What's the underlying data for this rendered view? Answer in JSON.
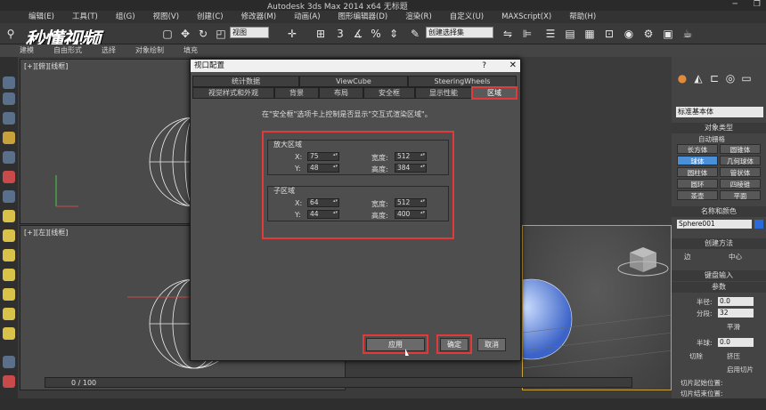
{
  "window": {
    "title": "Autodesk 3ds Max  2014 x64     无标题"
  },
  "menu": [
    "编辑(E)",
    "工具(T)",
    "组(G)",
    "视图(V)",
    "创建(C)",
    "修改器(M)",
    "动画(A)",
    "图形编辑器(D)",
    "渲染(R)",
    "自定义(U)",
    "MAXScript(X)",
    "帮助(H)"
  ],
  "toolbar": {
    "view_select": "视图",
    "selection_set": "创建选择集",
    "logo": "秒懂视频"
  },
  "ribbon": [
    "建模",
    "自由形式",
    "选择",
    "对象绘制",
    "填充"
  ],
  "viewports": {
    "top_left": "[+][俯][线框]",
    "bottom_left": "[+][左][线框]"
  },
  "right_panel": {
    "dropdown": "标准基本体",
    "object_type_header": "对象类型",
    "autogrid": "自动栅格",
    "buttons": [
      "长方体",
      "圆锥体",
      "球体",
      "几何球体",
      "圆柱体",
      "管状体",
      "圆环",
      "四棱锥",
      "茶壶",
      "平面"
    ],
    "active_button": "球体",
    "name_color_header": "名称和颜色",
    "name_value": "Sphere001",
    "create_method_header": "创建方法",
    "edge": "边",
    "center": "中心",
    "keyboard_input": "键盘输入",
    "params_header": "参数",
    "radius_label": "半径:",
    "radius_value": "0.0",
    "segments_label": "分段:",
    "segments_value": "32",
    "smooth": "平滑",
    "hemisphere_label": "半球:",
    "hemisphere_value": "0.0",
    "chop": "切除",
    "squash": "挤压",
    "enable_slice": "启用切片",
    "slice_from": "切片起始位置:",
    "slice_to": "切片结束位置:"
  },
  "timeline": {
    "label": "0 / 100"
  },
  "dialog": {
    "title": "视口配置",
    "help": "?",
    "close": "✕",
    "tabs_row1": [
      "统计数据",
      "ViewCube",
      "SteeringWheels"
    ],
    "tabs_row2": [
      "视觉样式和外观",
      "背景",
      "布局",
      "安全框",
      "显示性能",
      "区域"
    ],
    "active_tab": "区域",
    "description": "在\"安全框\"选项卡上控制是否显示\"交互式渲染区域\"。",
    "magnify": {
      "title": "放大区域",
      "x_label": "X:",
      "x": "75",
      "y_label": "Y:",
      "y": "48",
      "w_label": "宽度:",
      "w": "512",
      "h_label": "高度:",
      "h": "384"
    },
    "sub": {
      "title": "子区域",
      "x_label": "X:",
      "x": "64",
      "y_label": "Y:",
      "y": "44",
      "w_label": "宽度:",
      "w": "512",
      "h_label": "高度:",
      "h": "400"
    },
    "apply": "应用",
    "ok": "确定",
    "cancel": "取消"
  }
}
